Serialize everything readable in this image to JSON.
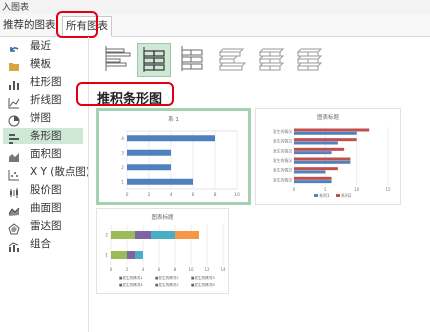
{
  "window": {
    "title": "入图表"
  },
  "tabs": [
    {
      "label": "推荐的图表"
    },
    {
      "label": "所有图表"
    }
  ],
  "sidebar": {
    "items": [
      {
        "label": "最近",
        "icon": "undo-icon"
      },
      {
        "label": "模板",
        "icon": "folder-icon"
      },
      {
        "label": "柱形图",
        "icon": "column-chart-icon"
      },
      {
        "label": "折线图",
        "icon": "line-chart-icon"
      },
      {
        "label": "饼图",
        "icon": "pie-chart-icon"
      },
      {
        "label": "条形图",
        "icon": "bar-chart-icon",
        "selected": true
      },
      {
        "label": "面积图",
        "icon": "area-chart-icon"
      },
      {
        "label": "X Y (散点图)",
        "icon": "scatter-chart-icon"
      },
      {
        "label": "股价图",
        "icon": "stock-chart-icon"
      },
      {
        "label": "曲面图",
        "icon": "surface-chart-icon"
      },
      {
        "label": "雷达图",
        "icon": "radar-chart-icon"
      },
      {
        "label": "组合",
        "icon": "combo-chart-icon"
      }
    ]
  },
  "subtypes": [
    {
      "name": "clustered-bar-subtype",
      "selected": false
    },
    {
      "name": "stacked-bar-subtype",
      "selected": true
    },
    {
      "name": "100-stacked-bar-subtype",
      "selected": false
    },
    {
      "name": "3d-clustered-bar-subtype",
      "selected": false
    },
    {
      "name": "3d-stacked-bar-subtype",
      "selected": false
    },
    {
      "name": "3d-100-stacked-bar-subtype",
      "selected": false
    }
  ],
  "heading": "推积条形图",
  "colors": {
    "accent_red": "#e10010",
    "selection_green": "#a3d2b1",
    "blue": "#4f81bd",
    "red": "#c0504d",
    "green": "#9bbb59",
    "purple": "#8064a2",
    "orange": "#f79646",
    "teal": "#4bacc6"
  },
  "chart_data": [
    {
      "type": "bar",
      "title": "系 1",
      "categories": [
        "1",
        "2",
        "3",
        "4"
      ],
      "series": [
        {
          "values": [
            6,
            4,
            4,
            8
          ]
        }
      ],
      "xlim": [
        0,
        10
      ],
      "xticks": [
        "0",
        "2",
        "4",
        "6",
        "8",
        "10"
      ]
    },
    {
      "type": "bar",
      "title": "图表标题",
      "categories": [
        "发生的情况",
        "发生的情况",
        "发生的情况",
        "发生的情况",
        "发生的情况",
        "发生的情况"
      ],
      "series": [
        {
          "values": [
            12,
            10,
            8,
            9,
            7,
            6
          ]
        },
        {
          "values": [
            10,
            7,
            6,
            9,
            5,
            6
          ]
        }
      ],
      "legend": [
        "系列1",
        "系列2"
      ],
      "xlim": [
        0,
        15
      ],
      "xticks": [
        "0",
        "5",
        "10",
        "15"
      ]
    },
    {
      "type": "bar",
      "title": "图表标题",
      "categories": [
        "2",
        "1"
      ],
      "series": [
        {
          "values": [
            3,
            2
          ]
        },
        {
          "values": [
            2,
            1
          ]
        },
        {
          "values": [
            3,
            1
          ]
        },
        {
          "values": [
            3,
            0
          ]
        }
      ],
      "xlim": [
        0,
        14
      ],
      "xticks": [
        "0",
        "2",
        "4",
        "6",
        "8",
        "10",
        "12",
        "14"
      ],
      "legend": [
        "■发生的情况1",
        "■发生的情况2",
        "■发生的情况3",
        "■发生的情况4",
        "■发生的情况5",
        "■发生的情况6"
      ]
    }
  ]
}
